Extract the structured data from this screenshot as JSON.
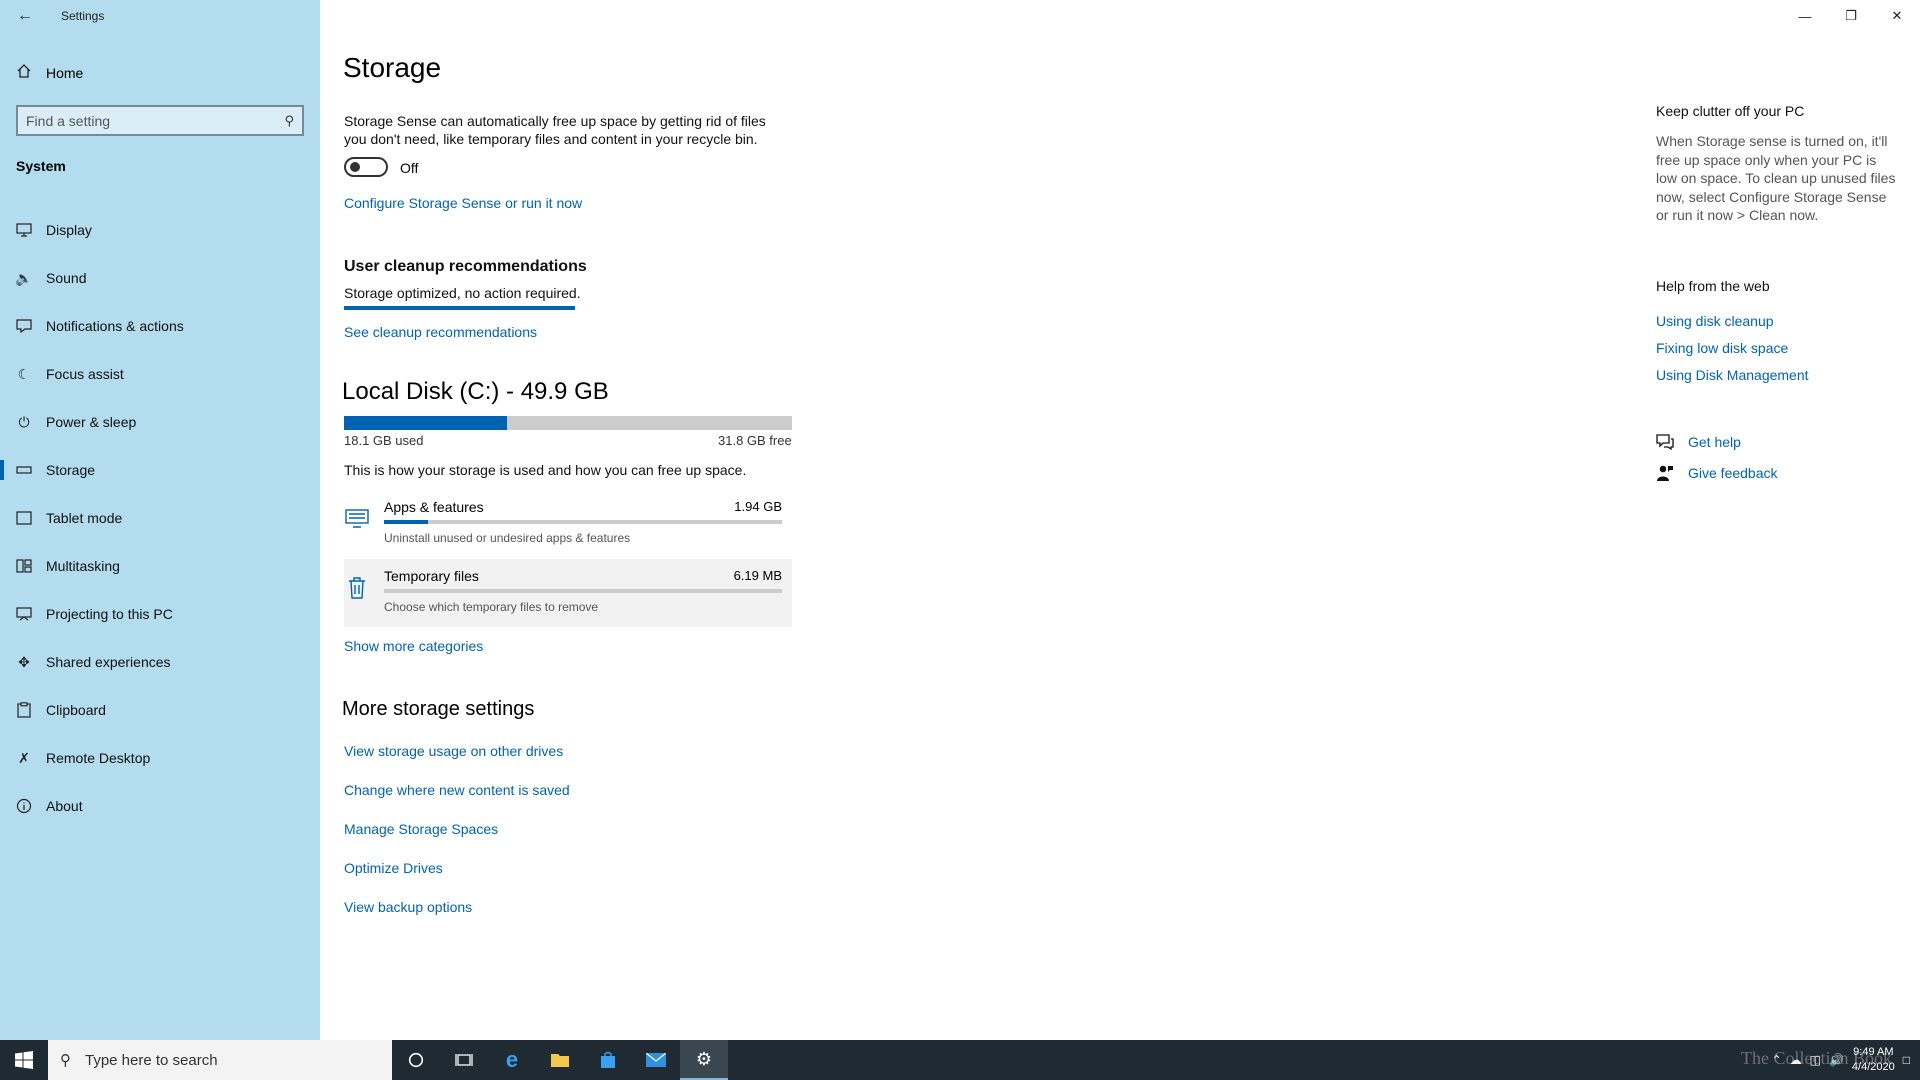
{
  "window": {
    "title": "Settings"
  },
  "sidebar": {
    "home_label": "Home",
    "search_placeholder": "Find a setting",
    "section": "System",
    "items": [
      {
        "label": "Display",
        "icon": "display-icon"
      },
      {
        "label": "Sound",
        "icon": "sound-icon"
      },
      {
        "label": "Notifications & actions",
        "icon": "notifications-icon"
      },
      {
        "label": "Focus assist",
        "icon": "focus-assist-icon"
      },
      {
        "label": "Power & sleep",
        "icon": "power-icon"
      },
      {
        "label": "Storage",
        "icon": "storage-icon",
        "active": true
      },
      {
        "label": "Tablet mode",
        "icon": "tablet-icon"
      },
      {
        "label": "Multitasking",
        "icon": "multitasking-icon"
      },
      {
        "label": "Projecting to this PC",
        "icon": "projecting-icon"
      },
      {
        "label": "Shared experiences",
        "icon": "shared-icon"
      },
      {
        "label": "Clipboard",
        "icon": "clipboard-icon"
      },
      {
        "label": "Remote Desktop",
        "icon": "remote-desktop-icon"
      },
      {
        "label": "About",
        "icon": "info-icon"
      }
    ]
  },
  "main": {
    "title": "Storage",
    "sense_desc_line1": "Storage Sense can automatically free up space by getting rid of files",
    "sense_desc_line2": "you don't need, like temporary files and content in your recycle bin.",
    "toggle_state": "Off",
    "configure_link": "Configure Storage Sense or run it now",
    "cleanup_heading": "User cleanup recommendations",
    "cleanup_status": "Storage optimized, no action required.",
    "cleanup_link": "See cleanup recommendations",
    "disk_title": "Local Disk (C:) - 49.9 GB",
    "disk_used": "18.1 GB used",
    "disk_free": "31.8 GB free",
    "disk_used_fraction": 0.363,
    "usage_desc": "This is how your storage is used and how you can free up space.",
    "categories": [
      {
        "name": "Apps & features",
        "size": "1.94 GB",
        "desc": "Uninstall unused or undesired apps & features",
        "fraction": 0.11,
        "icon": "apps-icon"
      },
      {
        "name": "Temporary files",
        "size": "6.19 MB",
        "desc": "Choose which temporary files to remove",
        "fraction": 0.0,
        "icon": "trash-icon"
      }
    ],
    "show_more": "Show more categories",
    "more_heading": "More storage settings",
    "more_links": [
      "View storage usage on other drives",
      "Change where new content is saved",
      "Manage Storage Spaces",
      "Optimize Drives",
      "View backup options"
    ]
  },
  "right": {
    "clutter_title": "Keep clutter off your PC",
    "clutter_text": "When Storage sense is turned on, it'll free up space only when your PC is low on space. To clean up unused files now, select Configure Storage Sense or run it now > Clean now.",
    "help_title": "Help from the web",
    "help_links": [
      "Using disk cleanup",
      "Fixing low disk space",
      "Using Disk Management"
    ],
    "get_help": "Get help",
    "give_feedback": "Give feedback"
  },
  "taskbar": {
    "search_placeholder": "Type here to search",
    "time": "9:49 AM",
    "date": "4/4/2020",
    "watermark": "The Collection Book"
  }
}
